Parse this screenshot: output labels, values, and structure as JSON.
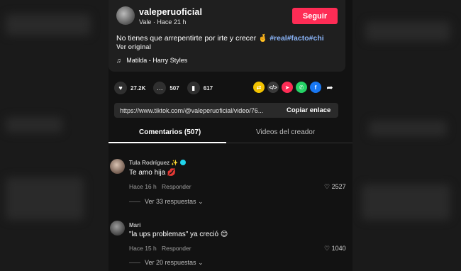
{
  "post": {
    "username": "valeperuoficial",
    "subline": "Vale · Hace 21 h",
    "follow_label": "Seguir",
    "caption_text": "No tienes que arrepentirte por irte y crecer 🤞",
    "hashtags": "#real#facto#chi",
    "see_original": "Ver original",
    "music": "Matilda - Harry Styles"
  },
  "actions": {
    "likes": "27.2K",
    "comments": "507",
    "saves": "617"
  },
  "link": {
    "url": "https://www.tiktok.com/@valeperuoficial/video/76...",
    "copy_label": "Copiar enlace"
  },
  "tabs": {
    "comments_label": "Comentarios (507)",
    "videos_label": "Videos del creador"
  },
  "comments": [
    {
      "author": "Tula Rodríguez ✨",
      "text": "Te amo hija 💋",
      "time": "Hace 16 h",
      "reply_label": "Responder",
      "likes": "2527",
      "replies": "Ver 33 respuestas"
    },
    {
      "author": "Mari",
      "text": "\"la ups problemas\" ya creció 😊",
      "time": "Hace 15 h",
      "reply_label": "Responder",
      "likes": "1040",
      "replies": "Ver 20 respuestas"
    }
  ],
  "colors": {
    "accent": "#fe2c55",
    "hashtag": "#8ab4f8"
  }
}
